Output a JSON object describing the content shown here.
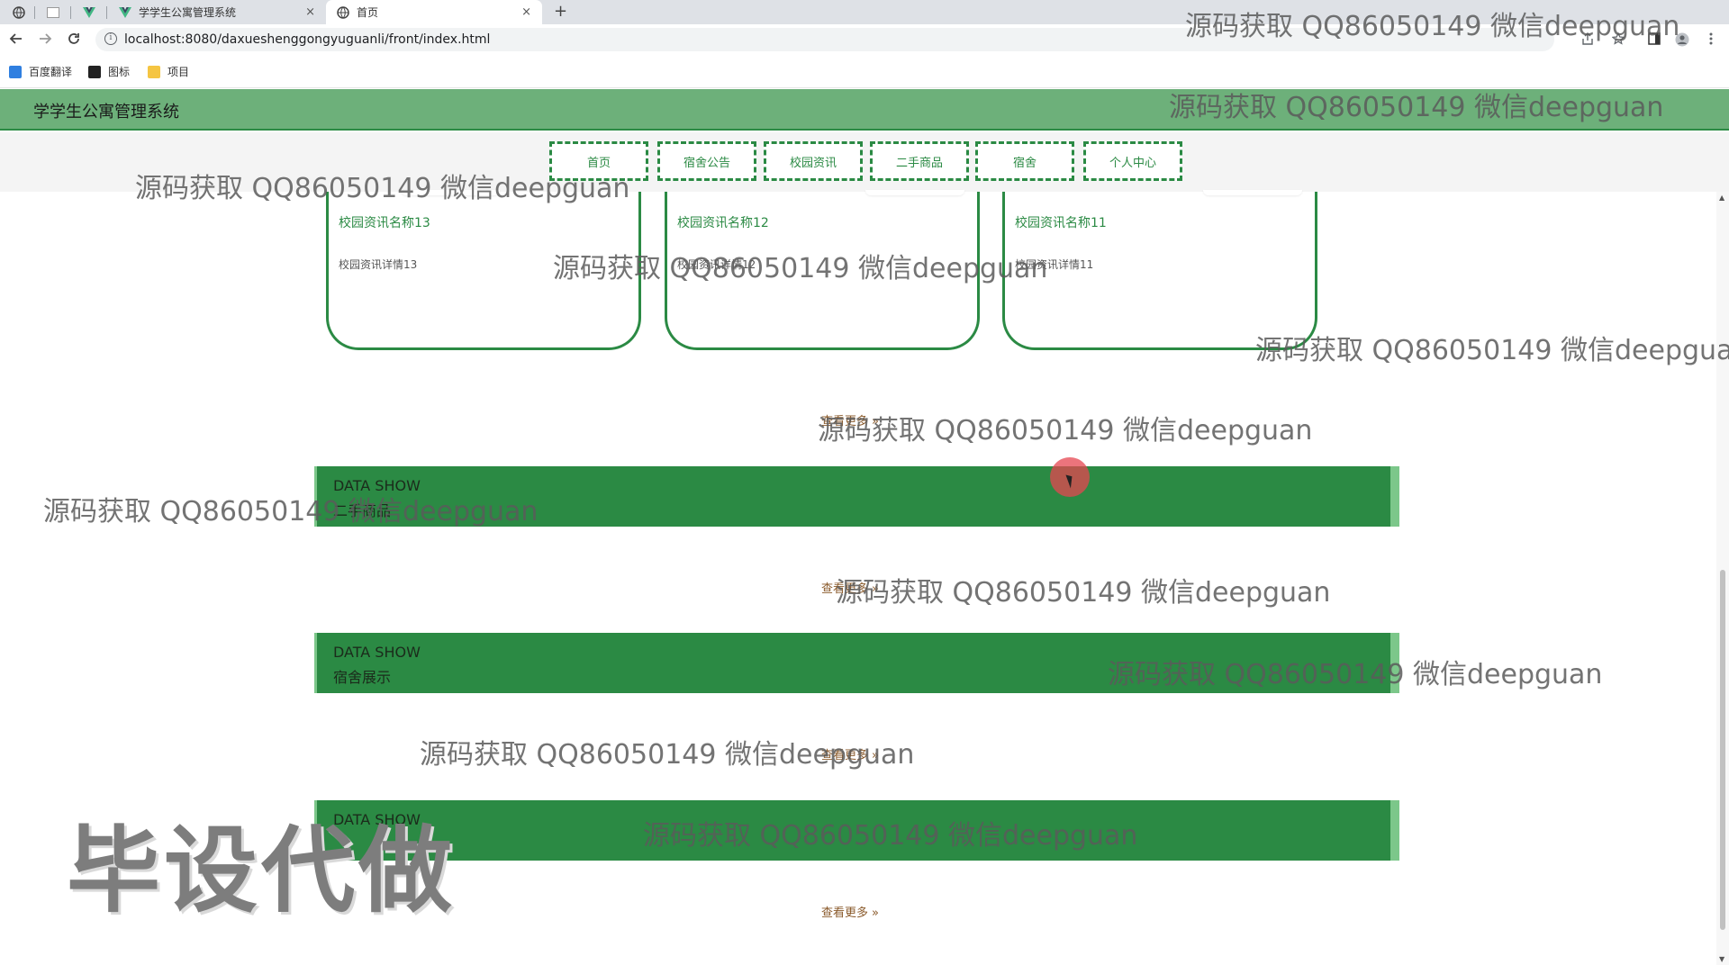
{
  "browser": {
    "tabs": [
      {
        "label": "",
        "icon": "globe-icon"
      },
      {
        "label": "",
        "icon": "blank-page-icon"
      },
      {
        "label": "",
        "icon": "vue-icon"
      },
      {
        "label": "学学生公寓管理系统",
        "icon": "vue-icon"
      },
      {
        "label": "首页",
        "icon": "globe-icon"
      }
    ],
    "new_tab_label": "+",
    "close_label": "×",
    "url": "localhost:8080/daxueshenggongyuguanli/front/index.html",
    "bookmarks": [
      {
        "label": "百度翻译",
        "color": "#2f7fe0"
      },
      {
        "label": "图标",
        "color": "#222222"
      },
      {
        "label": "项目",
        "color": "#f5c542"
      }
    ]
  },
  "site": {
    "title": "学学生公寓管理系统",
    "menu": [
      "首页",
      "宿舍公告",
      "校园资讯",
      "二手商品",
      "宿舍",
      "个人中心"
    ]
  },
  "news_cards": [
    {
      "name": "校园资讯名称13",
      "detail": "校园资讯详情13"
    },
    {
      "name": "校园资讯名称12",
      "detail": "校园资讯详情12"
    },
    {
      "name": "校园资讯名称11",
      "detail": "校园资讯详情11"
    }
  ],
  "sections": [
    {
      "en": "DATA SHOW",
      "cn": "二手商品"
    },
    {
      "en": "DATA SHOW",
      "cn": "宿舍展示"
    },
    {
      "en": "DATA SHOW",
      "cn": ""
    }
  ],
  "more_label": "查看更多",
  "more_chevron": "»",
  "watermark": {
    "text": "源码获取 QQ86050149 微信deepguan",
    "big": "毕设代做"
  },
  "colors": {
    "header_green": "#6db07a",
    "primary_green": "#2b8a44",
    "more_brown": "#8a5a2b"
  }
}
